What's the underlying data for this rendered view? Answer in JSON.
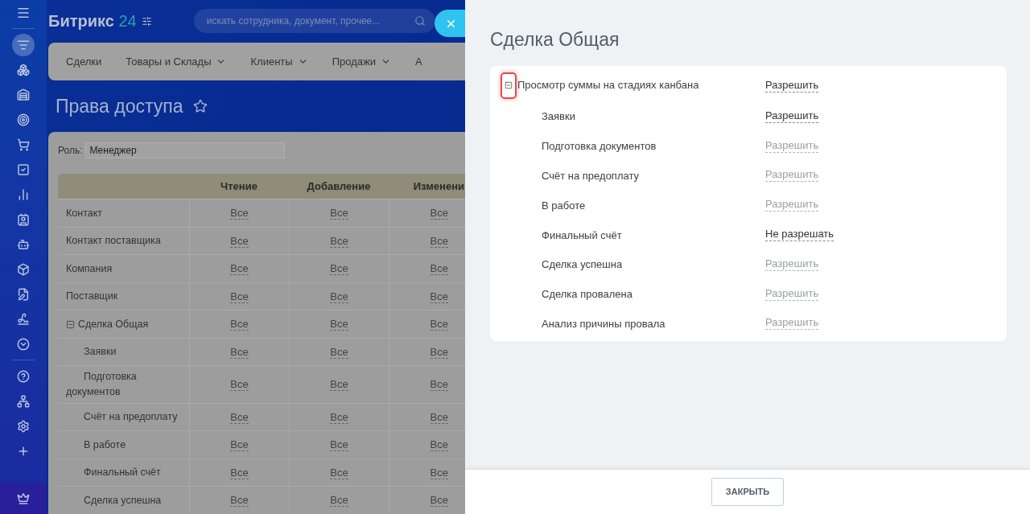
{
  "sidebar": {
    "items": [
      {
        "kind": "menu",
        "selected": false
      },
      {
        "kind": "filter",
        "selected": true
      },
      {
        "kind": "circles",
        "selected": false
      },
      {
        "kind": "warehouse",
        "selected": false
      },
      {
        "kind": "target",
        "selected": false
      },
      {
        "kind": "cart",
        "selected": false
      },
      {
        "kind": "task",
        "selected": false
      },
      {
        "kind": "chart",
        "selected": false
      },
      {
        "kind": "contact",
        "selected": false
      },
      {
        "kind": "robot",
        "selected": false
      },
      {
        "kind": "box",
        "selected": false
      },
      {
        "kind": "document",
        "selected": false
      },
      {
        "kind": "signature",
        "selected": false
      },
      {
        "kind": "more",
        "selected": false
      },
      {
        "kind": "help",
        "selected": false
      },
      {
        "kind": "network",
        "selected": false
      },
      {
        "kind": "settings",
        "selected": false
      },
      {
        "kind": "add",
        "selected": false
      },
      {
        "kind": "crown",
        "selected": false
      }
    ]
  },
  "brand": {
    "name": "Битрикс",
    "number": "24"
  },
  "search": {
    "placeholder": "искать сотрудника, документ, прочее..."
  },
  "nav": {
    "tabs": [
      {
        "label": "Сделки",
        "dropdown": false
      },
      {
        "label": "Товары и Склады",
        "dropdown": true
      },
      {
        "label": "Клиенты",
        "dropdown": true
      },
      {
        "label": "Продажи",
        "dropdown": true
      },
      {
        "label": "А",
        "dropdown": false
      }
    ]
  },
  "page": {
    "title": "Права доступа"
  },
  "role": {
    "label": "Роль:",
    "value": "Менеджер"
  },
  "table": {
    "columns": [
      "Чтение",
      "Добавление",
      "Изменени"
    ],
    "rows": [
      {
        "name": "Контакт",
        "values": [
          "Все",
          "Все",
          "Все"
        ]
      },
      {
        "name": "Контакт поставщика",
        "values": [
          "Все",
          "Все",
          "Все"
        ]
      },
      {
        "name": "Компания",
        "values": [
          "Все",
          "Все",
          "Все"
        ]
      },
      {
        "name": "Поставщик",
        "values": [
          "Все",
          "Все",
          "Все"
        ]
      },
      {
        "name": "Сделка Общая",
        "values": [
          "Все",
          "Все",
          "Все"
        ],
        "expanded": true,
        "children": [
          {
            "name": "Заявки",
            "values": [
              "Все",
              "Все",
              "Все"
            ]
          },
          {
            "name": "Подготовка документов",
            "values": [
              "Все",
              "Все",
              "Все"
            ]
          },
          {
            "name": "Счёт на предоплату",
            "values": [
              "Все",
              "Все",
              "Все"
            ]
          },
          {
            "name": "В работе",
            "values": [
              "Все",
              "Все",
              "Все"
            ]
          },
          {
            "name": "Финальный счёт",
            "values": [
              "Все",
              "Все",
              "Все"
            ]
          },
          {
            "name": "Сделка успешна",
            "values": [
              "Все",
              "Все",
              "Все"
            ]
          }
        ]
      }
    ]
  },
  "panel": {
    "title": "Сделка Общая",
    "permission": {
      "label": "Просмотр суммы на стадиях канбана",
      "value": "Разрешить",
      "expanded": true,
      "highlighted": true,
      "inherited": false,
      "children": [
        {
          "label": "Заявки",
          "value": "Разрешить",
          "inherited": false
        },
        {
          "label": "Подготовка документов",
          "value": "Разрешить",
          "inherited": true
        },
        {
          "label": "Счёт на предоплату",
          "value": "Разрешить",
          "inherited": true
        },
        {
          "label": "В работе",
          "value": "Разрешить",
          "inherited": true
        },
        {
          "label": "Финальный счёт",
          "value": "Не разрешать",
          "inherited": false
        },
        {
          "label": "Сделка успешна",
          "value": "Разрешить",
          "inherited": true
        },
        {
          "label": "Сделка провалена",
          "value": "Разрешить",
          "inherited": true
        },
        {
          "label": "Анализ причины провала",
          "value": "Разрешить",
          "inherited": true
        }
      ]
    },
    "close_button": "ЗАКРЫТЬ"
  }
}
